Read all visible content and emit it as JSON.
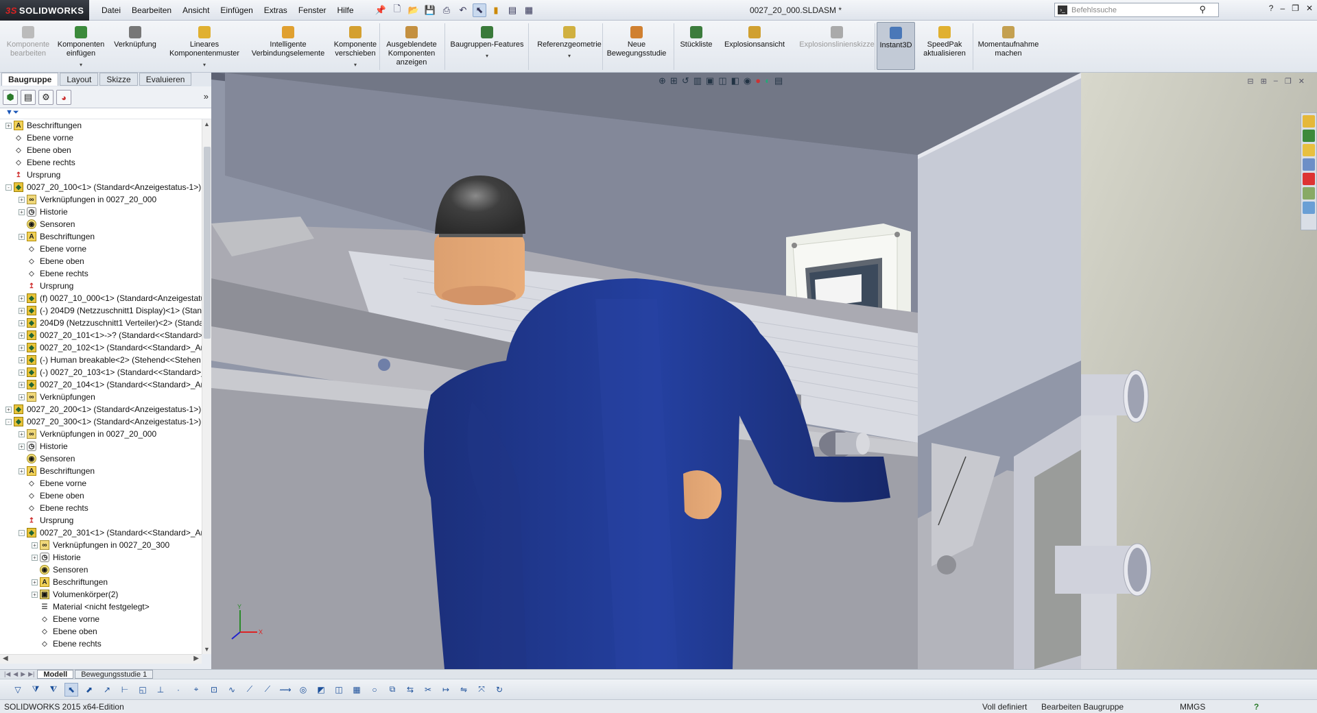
{
  "app": {
    "logo": "SOLIDWORKS",
    "doc_title": "0027_20_000.SLDASM *"
  },
  "menu": [
    "Datei",
    "Bearbeiten",
    "Ansicht",
    "Einfügen",
    "Extras",
    "Fenster",
    "Hilfe"
  ],
  "search": {
    "placeholder": "Befehlssuche"
  },
  "commands": [
    {
      "label": "Komponente bearbeiten",
      "icon": "edit-component-icon",
      "disabled": true
    },
    {
      "label": "Komponenten einfügen",
      "icon": "insert-components-icon"
    },
    {
      "label": "Verknüpfung",
      "icon": "mate-icon"
    },
    {
      "label": "Lineares Komponentenmuster",
      "icon": "linear-pattern-icon"
    },
    {
      "label": "Intelligente Verbindungselemente",
      "icon": "smart-fasteners-icon"
    },
    {
      "label": "Komponente verschieben",
      "icon": "move-component-icon"
    },
    {
      "label": "Ausgeblendete Komponenten anzeigen",
      "icon": "show-hidden-icon"
    },
    {
      "label": "Baugruppen-Features",
      "icon": "assembly-features-icon"
    },
    {
      "label": "Referenzgeometrie",
      "icon": "reference-geometry-icon"
    },
    {
      "label": "Neue Bewegungsstudie",
      "icon": "motion-study-icon"
    },
    {
      "label": "Stückliste",
      "icon": "bom-icon"
    },
    {
      "label": "Explosionsansicht",
      "icon": "exploded-view-icon"
    },
    {
      "label": "Explosionslinienskizze",
      "icon": "explode-line-icon",
      "disabled": true
    },
    {
      "label": "Instant3D",
      "icon": "instant3d-icon",
      "active": true
    },
    {
      "label": "SpeedPak aktualisieren",
      "icon": "speedpak-icon"
    },
    {
      "label": "Momentaufnahme machen",
      "icon": "snapshot-icon"
    }
  ],
  "fm_tabs": [
    "Baugruppe",
    "Layout",
    "Skizze",
    "Evaluieren"
  ],
  "tree": [
    {
      "t": "Beschriftungen",
      "lvl": 0,
      "ico": "a",
      "ex": "+"
    },
    {
      "t": "Ebene vorne",
      "lvl": 0,
      "ico": "pl"
    },
    {
      "t": "Ebene oben",
      "lvl": 0,
      "ico": "pl"
    },
    {
      "t": "Ebene rechts",
      "lvl": 0,
      "ico": "pl"
    },
    {
      "t": "Ursprung",
      "lvl": 0,
      "ico": "orig"
    },
    {
      "t": "0027_20_100<1> (Standard<Anzeigestatus-1>)",
      "lvl": 0,
      "ico": "asm",
      "ex": "-"
    },
    {
      "t": "Verknüpfungen in 0027_20_000",
      "lvl": 1,
      "ico": "mate",
      "ex": "+"
    },
    {
      "t": "Historie",
      "lvl": 1,
      "ico": "hist",
      "ex": "+"
    },
    {
      "t": "Sensoren",
      "lvl": 1,
      "ico": "sens"
    },
    {
      "t": "Beschriftungen",
      "lvl": 1,
      "ico": "a",
      "ex": "+"
    },
    {
      "t": "Ebene vorne",
      "lvl": 1,
      "ico": "pl"
    },
    {
      "t": "Ebene oben",
      "lvl": 1,
      "ico": "pl"
    },
    {
      "t": "Ebene rechts",
      "lvl": 1,
      "ico": "pl"
    },
    {
      "t": "Ursprung",
      "lvl": 1,
      "ico": "orig"
    },
    {
      "t": "(f) 0027_10_000<1> (Standard<Anzeigestatu",
      "lvl": 1,
      "ico": "asm",
      "ex": "+"
    },
    {
      "t": "(-) 204D9 (Netzzuschnitt1 Display)<1> (Stan",
      "lvl": 1,
      "ico": "asm",
      "ex": "+"
    },
    {
      "t": "204D9 (Netzzuschnitt1 Verteiler)<2> (Standa",
      "lvl": 1,
      "ico": "asm",
      "ex": "+"
    },
    {
      "t": "0027_20_101<1>->? (Standard<<Standard>_",
      "lvl": 1,
      "ico": "asm",
      "ex": "+"
    },
    {
      "t": "0027_20_102<1> (Standard<<Standard>_An",
      "lvl": 1,
      "ico": "asm",
      "ex": "+"
    },
    {
      "t": "(-) Human breakable<2> (Stehend<<Stehen",
      "lvl": 1,
      "ico": "asm",
      "ex": "+"
    },
    {
      "t": "(-) 0027_20_103<1> (Standard<<Standard>_",
      "lvl": 1,
      "ico": "asm",
      "ex": "+"
    },
    {
      "t": "0027_20_104<1> (Standard<<Standard>_An",
      "lvl": 1,
      "ico": "asm",
      "ex": "+"
    },
    {
      "t": "Verknüpfungen",
      "lvl": 1,
      "ico": "mate",
      "ex": "+"
    },
    {
      "t": "0027_20_200<1> (Standard<Anzeigestatus-1>)",
      "lvl": 0,
      "ico": "asm",
      "ex": "+"
    },
    {
      "t": "0027_20_300<1> (Standard<Anzeigestatus-1>)",
      "lvl": 0,
      "ico": "asm",
      "ex": "-"
    },
    {
      "t": "Verknüpfungen in 0027_20_000",
      "lvl": 1,
      "ico": "mate",
      "ex": "+"
    },
    {
      "t": "Historie",
      "lvl": 1,
      "ico": "hist",
      "ex": "+"
    },
    {
      "t": "Sensoren",
      "lvl": 1,
      "ico": "sens"
    },
    {
      "t": "Beschriftungen",
      "lvl": 1,
      "ico": "a",
      "ex": "+"
    },
    {
      "t": "Ebene vorne",
      "lvl": 1,
      "ico": "pl"
    },
    {
      "t": "Ebene oben",
      "lvl": 1,
      "ico": "pl"
    },
    {
      "t": "Ebene rechts",
      "lvl": 1,
      "ico": "pl"
    },
    {
      "t": "Ursprung",
      "lvl": 1,
      "ico": "orig"
    },
    {
      "t": "0027_20_301<1> (Standard<<Standard>_An",
      "lvl": 1,
      "ico": "asm",
      "ex": "-"
    },
    {
      "t": "Verknüpfungen in 0027_20_300",
      "lvl": 2,
      "ico": "mate",
      "ex": "+"
    },
    {
      "t": "Historie",
      "lvl": 2,
      "ico": "hist",
      "ex": "+"
    },
    {
      "t": "Sensoren",
      "lvl": 2,
      "ico": "sens"
    },
    {
      "t": "Beschriftungen",
      "lvl": 2,
      "ico": "a",
      "ex": "+"
    },
    {
      "t": "Volumenkörper(2)",
      "lvl": 2,
      "ico": "body",
      "ex": "+"
    },
    {
      "t": "Material <nicht festgelegt>",
      "lvl": 2,
      "ico": "mat"
    },
    {
      "t": "Ebene vorne",
      "lvl": 2,
      "ico": "pl"
    },
    {
      "t": "Ebene oben",
      "lvl": 2,
      "ico": "pl"
    },
    {
      "t": "Ebene rechts",
      "lvl": 2,
      "ico": "pl"
    }
  ],
  "bottom_tabs": [
    "Modell",
    "Bewegungsstudie 1"
  ],
  "triad": {
    "y": "Y",
    "x": "X"
  },
  "status": {
    "edition": "SOLIDWORKS 2015 x64-Edition",
    "defined": "Voll definiert",
    "mode": "Bearbeiten Baugruppe",
    "units": "MMGS"
  },
  "colors": {
    "accent": "#1f4fa0",
    "shirt": "#1c3a8f",
    "skin": "#e8a672",
    "helmet": "#3a3a3a"
  }
}
